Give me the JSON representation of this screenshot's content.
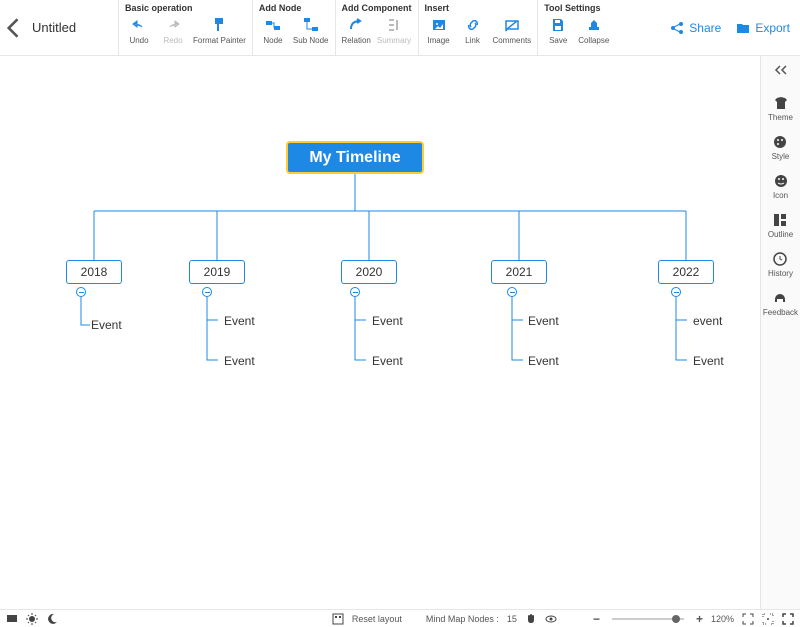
{
  "title": "Untitled",
  "groups": {
    "basic": {
      "title": "Basic operation",
      "undo": "Undo",
      "redo": "Redo",
      "format_painter": "Format Painter"
    },
    "add_node": {
      "title": "Add Node",
      "node": "Node",
      "sub_node": "Sub Node"
    },
    "add_component": {
      "title": "Add Component",
      "relation": "Relation",
      "summary": "Summary"
    },
    "insert": {
      "title": "Insert",
      "image": "Image",
      "link": "Link",
      "comments": "Comments"
    },
    "tool_settings": {
      "title": "Tool Settings",
      "save": "Save",
      "collapse": "Collapse"
    }
  },
  "actions": {
    "share": "Share",
    "export": "Export"
  },
  "rightbar": {
    "theme": "Theme",
    "style": "Style",
    "icon": "Icon",
    "outline": "Outline",
    "history": "History",
    "feedback": "Feedback"
  },
  "mindmap": {
    "root": "My Timeline",
    "branches": [
      {
        "year": "2018",
        "leaves": [
          "Event"
        ]
      },
      {
        "year": "2019",
        "leaves": [
          "Event",
          "Event"
        ]
      },
      {
        "year": "2020",
        "leaves": [
          "Event",
          "Event"
        ]
      },
      {
        "year": "2021",
        "leaves": [
          "Event",
          "Event"
        ]
      },
      {
        "year": "2022",
        "leaves": [
          "event",
          "Event"
        ]
      }
    ]
  },
  "status": {
    "reset_layout": "Reset layout",
    "nodes_label": "Mind Map Nodes :",
    "nodes_count": "15",
    "zoom": "120%"
  }
}
